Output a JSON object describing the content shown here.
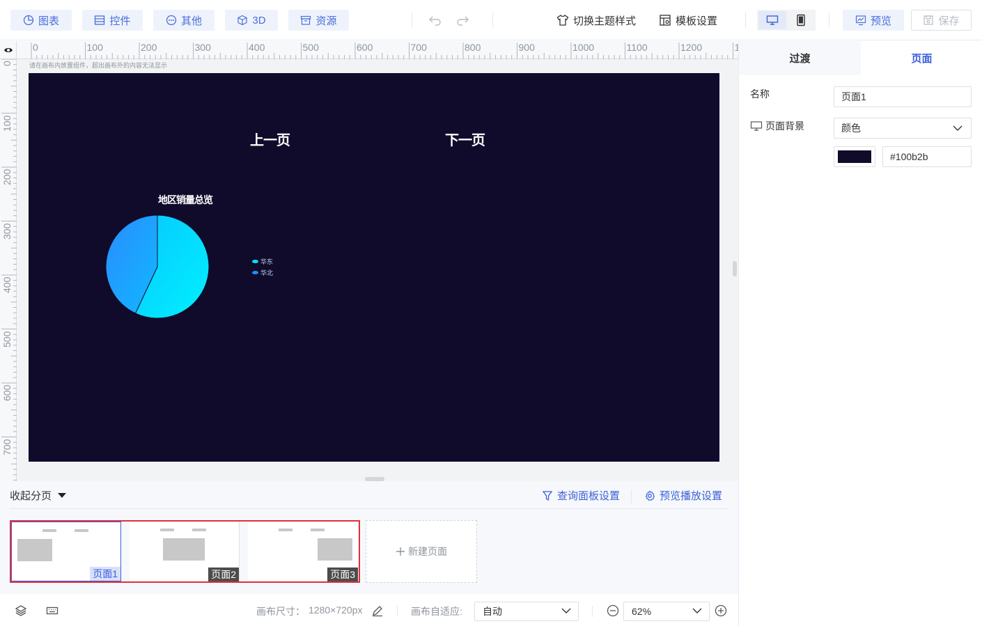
{
  "toolbar": {
    "chart": "图表",
    "widget": "控件",
    "other": "其他",
    "three_d": "3D",
    "resource": "资源",
    "switch_theme": "切换主题样式",
    "template_settings": "模板设置",
    "preview": "预览",
    "save": "保存"
  },
  "ruler": {
    "h_labels": [
      "0",
      "100",
      "200",
      "300",
      "400",
      "500",
      "600",
      "700",
      "800",
      "900",
      "1000",
      "1100",
      "1200",
      "1"
    ],
    "v_labels": [
      "0",
      "100",
      "200",
      "300",
      "400",
      "500",
      "600",
      "700"
    ]
  },
  "canvas": {
    "hint": "请在画布内放置组件，超出画布外的内容无法显示",
    "background": "#100b2b",
    "prev_button": "上一页",
    "next_button": "下一页"
  },
  "chart_data": {
    "type": "pie",
    "title": "地区销量总览",
    "categories": [
      "华东",
      "华北"
    ],
    "values": [
      57,
      43
    ],
    "colors": [
      "#00e5ff",
      "#1e90ff"
    ],
    "legend": "right"
  },
  "pages_panel": {
    "collapse": "收起分页",
    "query_panel_settings": "查询面板设置",
    "preview_play_settings": "预览播放设置",
    "pages": [
      {
        "label": "页面1",
        "active": true
      },
      {
        "label": "页面2",
        "active": false
      },
      {
        "label": "页面3",
        "active": false
      }
    ],
    "new_page": "新建页面"
  },
  "status": {
    "canvas_size_label": "画布尺寸：",
    "canvas_size_value": "1280×720px",
    "adapt_label": "画布自适应:",
    "adapt_value": "自动",
    "zoom_value": "62%"
  },
  "right_panel": {
    "tab_transition": "过渡",
    "tab_page": "页面",
    "name_label": "名称",
    "name_value": "页面1",
    "bg_label": "页面背景",
    "bg_type": "颜色",
    "bg_hex": "#100b2b"
  },
  "colors": {
    "accent": "#3c5fd8",
    "selection": "#e0303a"
  }
}
